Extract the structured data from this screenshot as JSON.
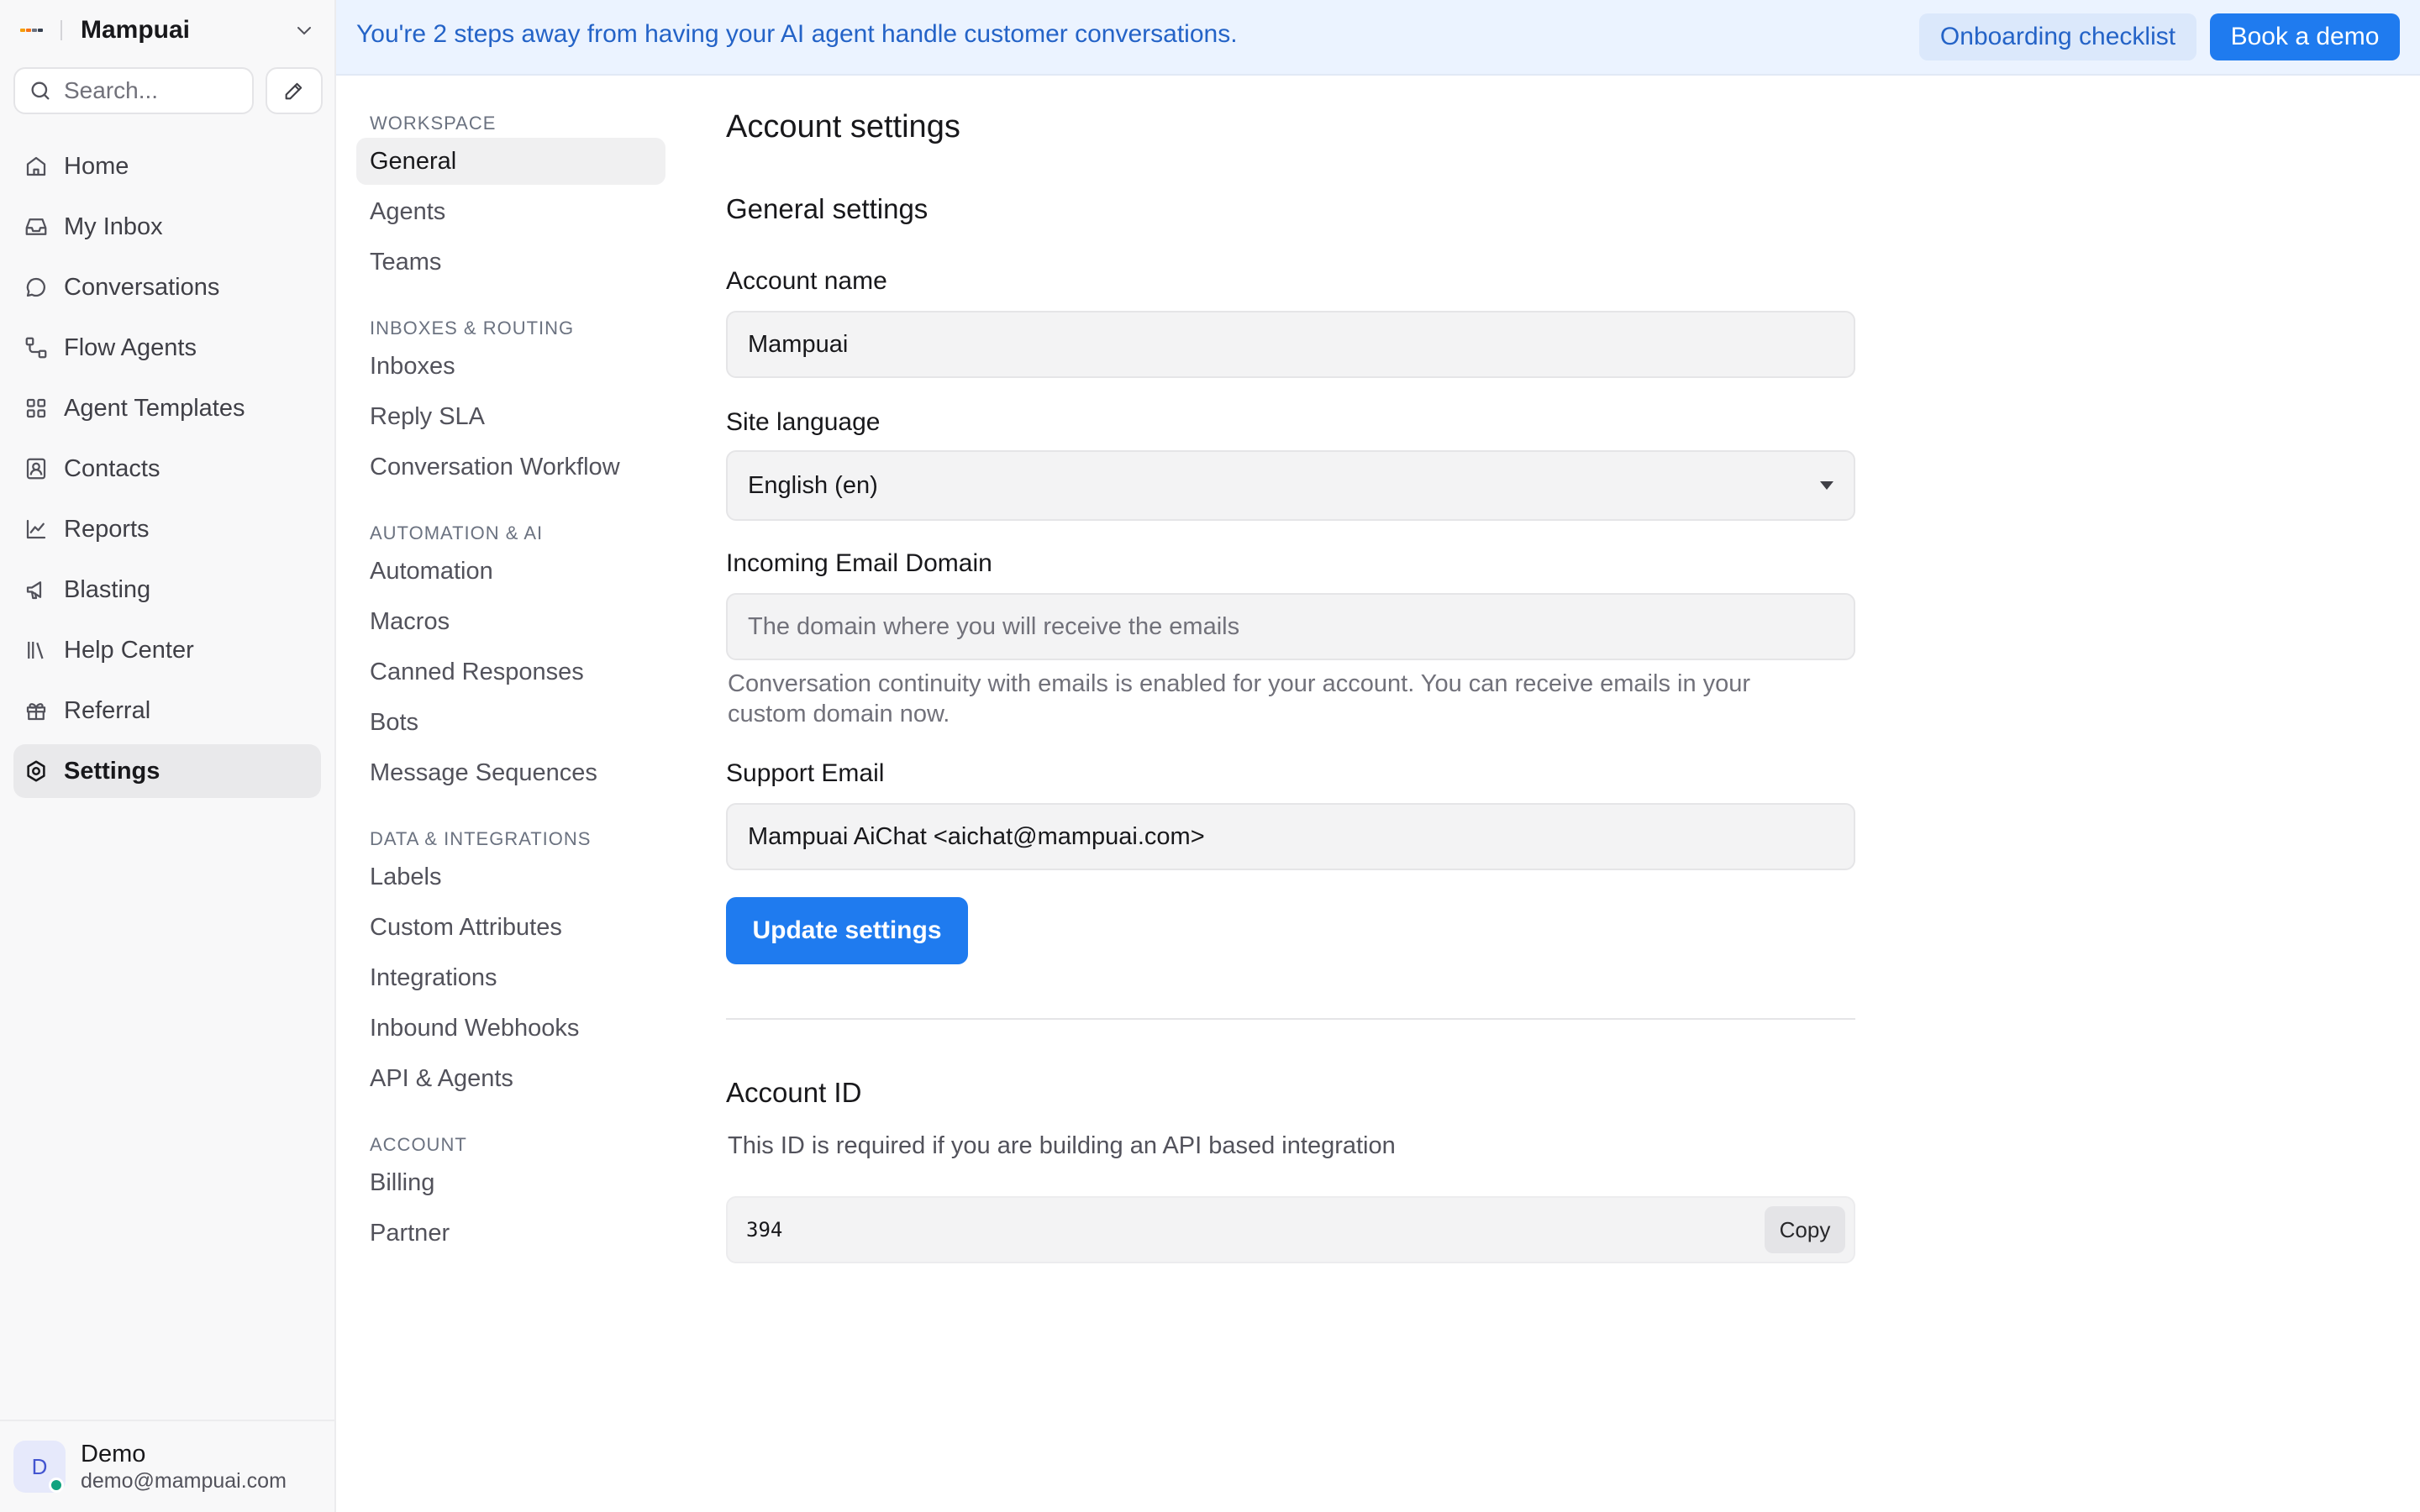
{
  "brand": {
    "name": "Mampuai",
    "logo_colors": [
      "#f59e0b",
      "#f97316",
      "#6b7280",
      "#374151"
    ]
  },
  "search": {
    "placeholder": "Search..."
  },
  "nav": {
    "items": [
      {
        "label": "Home",
        "icon": "home-icon"
      },
      {
        "label": "My Inbox",
        "icon": "inbox-icon"
      },
      {
        "label": "Conversations",
        "icon": "chat-bubble-icon"
      },
      {
        "label": "Flow Agents",
        "icon": "flow-icon"
      },
      {
        "label": "Agent Templates",
        "icon": "grid-icon"
      },
      {
        "label": "Contacts",
        "icon": "contact-card-icon"
      },
      {
        "label": "Reports",
        "icon": "line-chart-icon"
      },
      {
        "label": "Blasting",
        "icon": "megaphone-icon"
      },
      {
        "label": "Help Center",
        "icon": "library-icon"
      },
      {
        "label": "Referral",
        "icon": "gift-icon"
      },
      {
        "label": "Settings",
        "icon": "settings-icon",
        "active": true
      }
    ]
  },
  "user": {
    "initial": "D",
    "name": "Demo",
    "email": "demo@mampuai.com",
    "status_color": "#10a37f"
  },
  "banner": {
    "text": "You're 2 steps away from having your AI agent handle customer conversations.",
    "checklist_label": "Onboarding checklist",
    "demo_label": "Book a demo"
  },
  "subnav": {
    "groups": [
      {
        "title": "WORKSPACE",
        "items": [
          "General",
          "Agents",
          "Teams"
        ]
      },
      {
        "title": "INBOXES & ROUTING",
        "items": [
          "Inboxes",
          "Reply SLA",
          "Conversation Workflow"
        ]
      },
      {
        "title": "AUTOMATION & AI",
        "items": [
          "Automation",
          "Macros",
          "Canned Responses",
          "Bots",
          "Message Sequences"
        ]
      },
      {
        "title": "DATA & INTEGRATIONS",
        "items": [
          "Labels",
          "Custom Attributes",
          "Integrations",
          "Inbound Webhooks",
          "API & Agents"
        ]
      },
      {
        "title": "ACCOUNT",
        "items": [
          "Billing",
          "Partner"
        ]
      }
    ],
    "active": "General"
  },
  "main": {
    "title": "Account settings",
    "section_title": "General settings",
    "account_name": {
      "label": "Account name",
      "value": "Mampuai"
    },
    "site_language": {
      "label": "Site language",
      "value": "English (en)"
    },
    "incoming_email": {
      "label": "Incoming Email Domain",
      "placeholder": "The domain where you will receive the emails",
      "help": "Conversation continuity with emails is enabled for your account. You can receive emails in your custom domain now."
    },
    "support_email": {
      "label": "Support Email",
      "value": "Mampuai AiChat <aichat@mampuai.com>"
    },
    "update_label": "Update settings",
    "account_id": {
      "title": "Account ID",
      "description": "This ID is required if you are building an API based integration",
      "value": "394",
      "copy_label": "Copy"
    }
  },
  "colors": {
    "accent": "#1f7bef",
    "banner_bg": "#ebf3ff",
    "banner_text": "#2463c7"
  }
}
